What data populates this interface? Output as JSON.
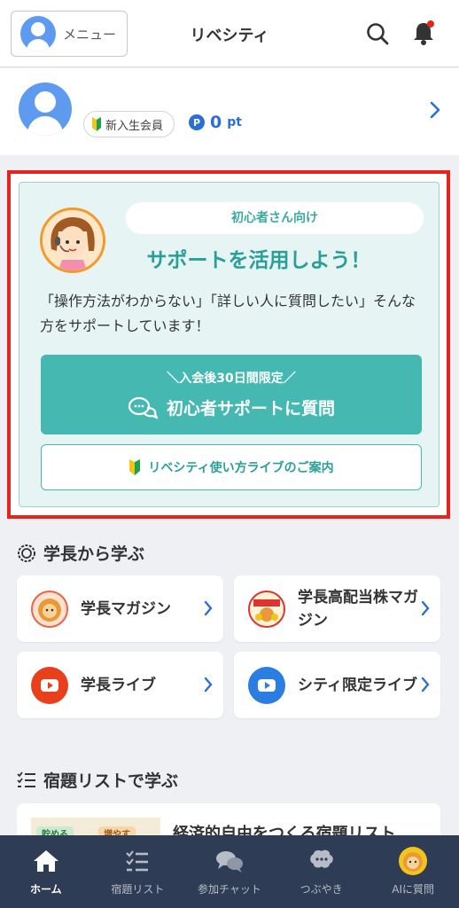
{
  "header": {
    "menu_label": "メニュー",
    "title": "リベシティ",
    "icons": [
      "avatar-icon",
      "search-icon",
      "bell-icon"
    ]
  },
  "profile": {
    "rank": "新入生会員",
    "points_icon": "P",
    "points": "0",
    "points_unit": "pt"
  },
  "support": {
    "tag": "初心者さん向け",
    "heading": "サポートを活用しよう！",
    "description": "「操作方法がわからない」「詳しい人に質問したい」そんな方をサポートしています！",
    "cta_sub": "＼入会後30日間限定／",
    "cta_main": "初心者サポートに質問",
    "secondary": "リベシティ使い方ライブのご案内"
  },
  "learn_section": {
    "title": "学長から学ぶ",
    "cards": [
      {
        "label": "学長マガジン",
        "icon": "lion-icon"
      },
      {
        "label": "学長高配当株マガジン",
        "icon": "dividend-magazine-icon"
      },
      {
        "label": "学長ライブ",
        "icon": "youtube-icon"
      },
      {
        "label": "シティ限定ライブ",
        "icon": "youtube-icon"
      }
    ]
  },
  "homework_section": {
    "title": "宿題リストで学ぶ",
    "item_title": "経済的自由をつくる宿題リスト",
    "tags": [
      "貯める",
      "増やす"
    ]
  },
  "bottom_nav": [
    {
      "label": "ホーム",
      "icon": "home-icon",
      "active": true
    },
    {
      "label": "宿題リスト",
      "icon": "checklist-icon",
      "active": false
    },
    {
      "label": "参加チャット",
      "icon": "chat-icon",
      "active": false
    },
    {
      "label": "つぶやき",
      "icon": "tweet-icon",
      "active": false
    },
    {
      "label": "AIに質問",
      "icon": "ai-lion-icon",
      "active": false
    }
  ],
  "colors": {
    "accent_teal": "#45b8b1",
    "highlight_red": "#e8231c",
    "points_blue": "#2b6fd6",
    "nav_bg": "#2f3c55"
  }
}
